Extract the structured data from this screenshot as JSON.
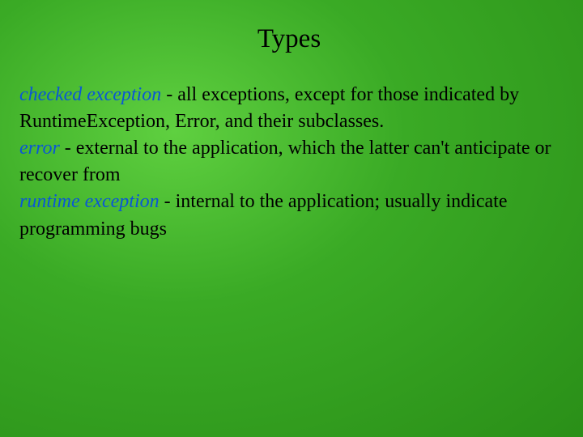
{
  "title": "Types",
  "entries": [
    {
      "term": "checked exception",
      "desc": " - all exceptions, except for those indicated by RuntimeException, Error, and their subclasses."
    },
    {
      "term": "error",
      "desc": " - external to the application, which the latter can't anticipate or recover from"
    },
    {
      "term": "runtime exception",
      "desc": " - internal to the application; usually indicate programming bugs"
    }
  ]
}
